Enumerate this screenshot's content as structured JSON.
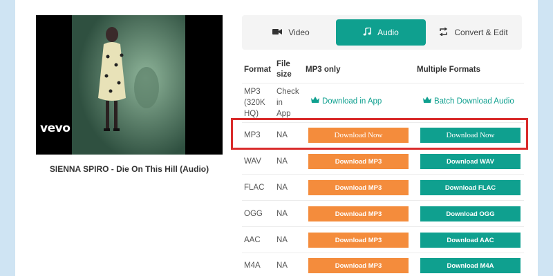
{
  "video": {
    "title": "SIENNA SPIRO - Die On This Hill (Audio)",
    "watermark": "vevo"
  },
  "tabs": [
    {
      "label": "Video",
      "icon": "video-camera-icon",
      "active": false
    },
    {
      "label": "Audio",
      "icon": "music-note-icon",
      "active": true
    },
    {
      "label": "Convert & Edit",
      "icon": "convert-arrows-icon",
      "active": false
    }
  ],
  "table": {
    "headers": {
      "format": "Format",
      "filesize_line1": "File",
      "filesize_line2": "size",
      "mp3only": "MP3 only",
      "multiple": "Multiple Formats"
    },
    "premium_row": {
      "format_l1": "MP3",
      "format_l2": "(320K",
      "format_l3": "HQ)",
      "size_l1": "Check",
      "size_l2": "in",
      "size_l3": "App",
      "app_link": "Download in App",
      "batch_link": "Batch Download Audio"
    },
    "rows": [
      {
        "format": "MP3",
        "size": "NA",
        "left": "Download Now",
        "right": "Download Now"
      },
      {
        "format": "WAV",
        "size": "NA",
        "left": "Download MP3",
        "right": "Download WAV"
      },
      {
        "format": "FLAC",
        "size": "NA",
        "left": "Download MP3",
        "right": "Download FLAC"
      },
      {
        "format": "OGG",
        "size": "NA",
        "left": "Download MP3",
        "right": "Download OGG"
      },
      {
        "format": "AAC",
        "size": "NA",
        "left": "Download MP3",
        "right": "Download AAC"
      },
      {
        "format": "M4A",
        "size": "NA",
        "left": "Download MP3",
        "right": "Download M4A"
      }
    ]
  },
  "colors": {
    "accent": "#0fa08f",
    "orange": "#f48c3c",
    "highlight": "#d92b2b",
    "background": "#cfe4f3"
  }
}
